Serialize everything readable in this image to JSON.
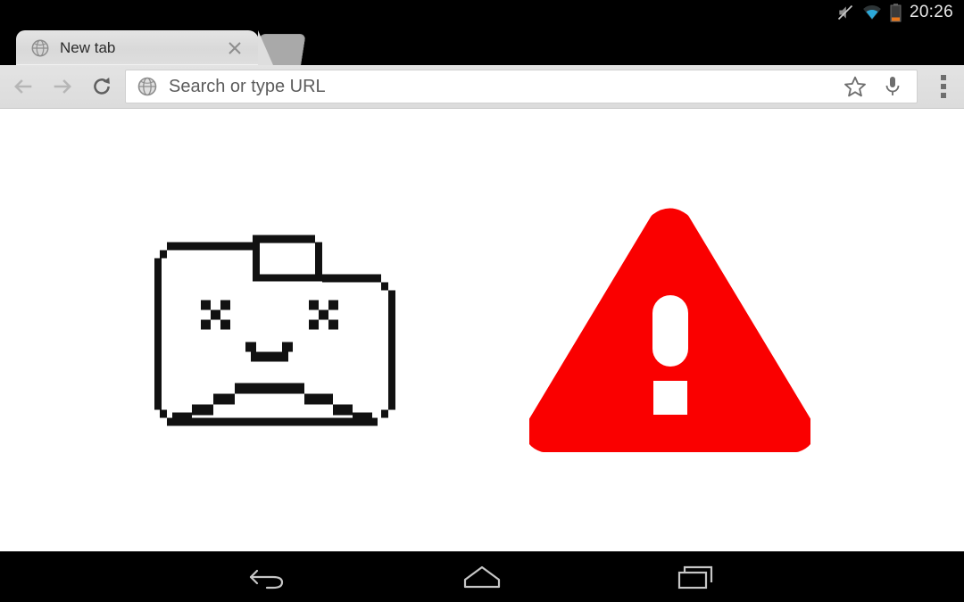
{
  "status_bar": {
    "time": "20:26",
    "icons": [
      {
        "name": "mute-icon",
        "label": "silent-mode"
      },
      {
        "name": "wifi-icon",
        "label": "wifi-connected"
      },
      {
        "name": "battery-icon",
        "label": "battery-low"
      }
    ],
    "background_color": "#000000",
    "text_color": "#e8e8e8",
    "battery_level_color": "#e8761a"
  },
  "tab_strip": {
    "background_color": "#000000",
    "tabs": [
      {
        "title": "New tab",
        "favicon": "globe-icon",
        "close": "close-icon",
        "active": true
      }
    ],
    "background_tab": {
      "name": "background-tab",
      "color": "#a9a9a9"
    }
  },
  "toolbar": {
    "back": {
      "name": "back-arrow-icon",
      "enabled": false
    },
    "forward": {
      "name": "forward-arrow-icon",
      "enabled": false
    },
    "reload": {
      "name": "reload-icon",
      "enabled": true
    },
    "omnibox": {
      "icon": "globe-icon",
      "placeholder": "Search or type URL",
      "value": ""
    },
    "bookmark": {
      "name": "star-icon"
    },
    "voice_search": {
      "name": "microphone-icon"
    },
    "menu": {
      "name": "overflow-menu-icon"
    },
    "background_color": "#dedede",
    "field_color": "#ffffff"
  },
  "page": {
    "background_color": "#ffffff",
    "graphics": [
      {
        "name": "sad-folder-icon",
        "description": "pixel-art folder with X eyes and frowning mouth",
        "color": "#111111"
      },
      {
        "name": "warning-triangle-icon",
        "description": "red rounded triangle with white exclamation mark",
        "color": "#fa0000",
        "mark_color": "#ffffff"
      }
    ]
  },
  "nav_bar": {
    "background_color": "#000000",
    "buttons": [
      {
        "name": "android-back-button",
        "label": "Back"
      },
      {
        "name": "android-home-button",
        "label": "Home"
      },
      {
        "name": "android-recents-button",
        "label": "Recent apps"
      }
    ]
  }
}
